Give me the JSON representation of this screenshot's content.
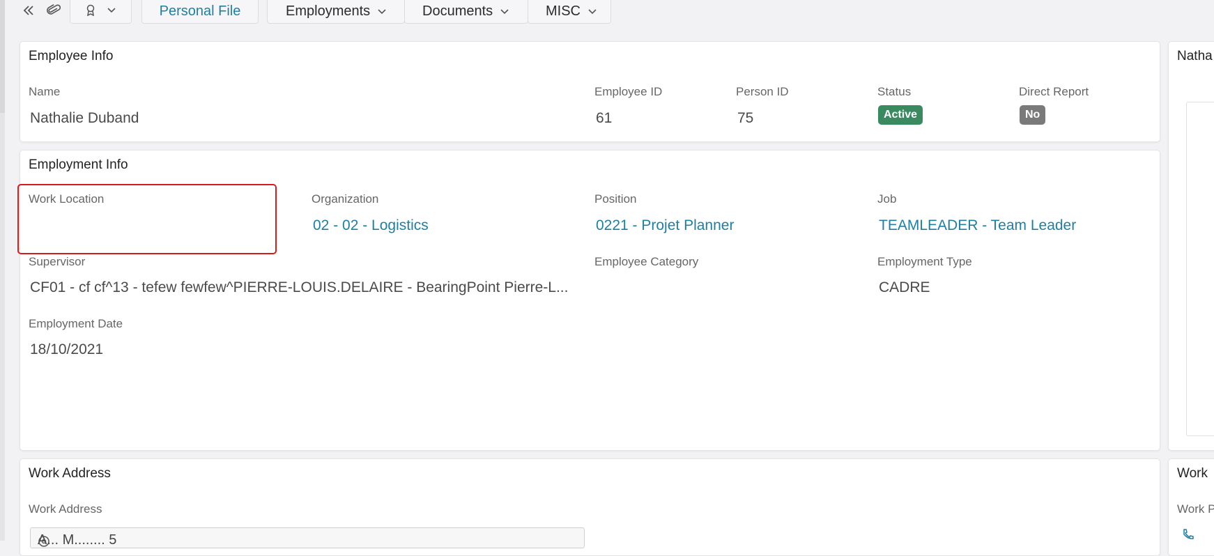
{
  "toolbar": {
    "tabs": [
      {
        "label": "Personal File"
      },
      {
        "label": "Employments"
      },
      {
        "label": "Documents"
      },
      {
        "label": "MISC"
      }
    ]
  },
  "employee_info": {
    "title": "Employee Info",
    "name_label": "Name",
    "name_value": "Nathalie Duband",
    "employee_id_label": "Employee ID",
    "employee_id_value": "61",
    "person_id_label": "Person ID",
    "person_id_value": "75",
    "status_label": "Status",
    "status_value": "Active",
    "direct_report_label": "Direct Report",
    "direct_report_value": "No"
  },
  "employment_info": {
    "title": "Employment Info",
    "work_location_label": "Work Location",
    "work_location_value": "",
    "organization_label": "Organization",
    "organization_value": "02 - 02 - Logistics",
    "position_label": "Position",
    "position_value": "0221 - Projet Planner",
    "job_label": "Job",
    "job_value": "TEAMLEADER - Team Leader",
    "supervisor_label": "Supervisor",
    "supervisor_value": "CF01 - cf cf^13 - tefew fewfew^PIERRE-LOUIS.DELAIRE - BearingPoint Pierre-L...",
    "employee_category_label": "Employee Category",
    "employee_category_value": "",
    "employment_type_label": "Employment Type",
    "employment_type_value": "CADRE",
    "employment_date_label": "Employment Date",
    "employment_date_value": "18/10/2021"
  },
  "side_panel": {
    "title_partial": "Natha",
    "work_title_partial": "Work",
    "work_p_partial": "Work P"
  },
  "work_address": {
    "title": "Work Address",
    "field_label": "Work Address",
    "field_value_partial": "A... M........ 5"
  },
  "colors": {
    "accent": "#1f7fa3",
    "status_active": "#3a8a5f",
    "badge_no": "#7a7a7a",
    "highlight": "#d81b1b"
  }
}
